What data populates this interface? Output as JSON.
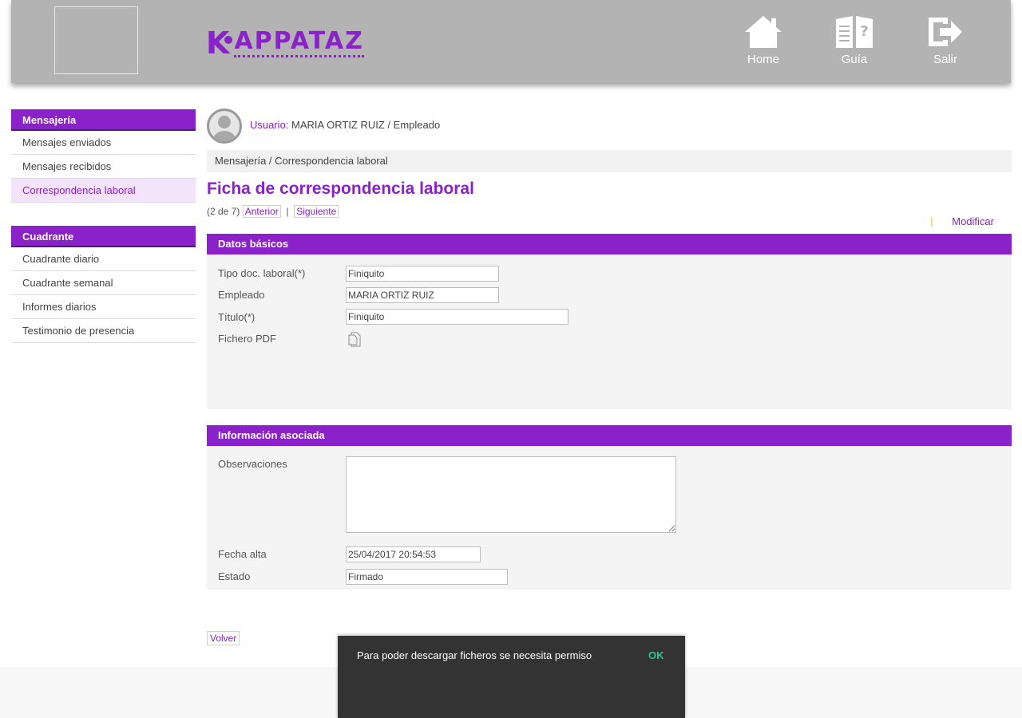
{
  "header": {
    "brand": {
      "k": "K",
      "text": "APPATAZ"
    },
    "nav": [
      {
        "label": "Home",
        "icon": "home-icon"
      },
      {
        "label": "Guía",
        "icon": "book-help-icon"
      },
      {
        "label": "Salir",
        "icon": "exit-icon"
      }
    ]
  },
  "sidebar": {
    "groups": [
      {
        "title": "Mensajería",
        "items": [
          "Mensajes enviados",
          "Mensajes recibidos",
          "Correspondencia laboral"
        ],
        "active": "Correspondencia laboral"
      },
      {
        "title": "Cuadrante",
        "items": [
          "Cuadrante diario",
          "Cuadrante semanal",
          "Informes diarios",
          "Testimonio de presencia"
        ]
      }
    ]
  },
  "user": {
    "label": "Usuario:",
    "value": "MARIA ORTIZ RUIZ / Empleado"
  },
  "breadcrumb": "Mensajería / Correspondencia laboral",
  "page_title": "Ficha de correspondencia laboral",
  "pager": {
    "position": "(2 de 7)",
    "prev": "Anterior",
    "separator": "|",
    "next": "Siguiente"
  },
  "actions": {
    "modify": "Modificar"
  },
  "sections": {
    "basic": {
      "title": "Datos básicos",
      "fields": {
        "tipo_label": "Tipo doc. laboral(*)",
        "tipo_value": "Finiquito",
        "empleado_label": "Empleado",
        "empleado_value": "MARIA ORTIZ RUIZ",
        "titulo_label": "Título(*)",
        "titulo_value": "Finiquito",
        "pdf_label": "Fichero PDF"
      }
    },
    "info": {
      "title": "Información asociada",
      "fields": {
        "obs_label": "Observaciones",
        "obs_value": "",
        "fecha_label": "Fecha alta",
        "fecha_value": "25/04/2017 20:54:53",
        "estado_label": "Estado",
        "estado_value": "Firmado"
      }
    }
  },
  "back_button": "Volver",
  "snackbar": {
    "message": "Para poder descargar ficheros se necesita permiso",
    "action": "OK"
  },
  "colors": {
    "accent": "#8a21c9",
    "header_bg": "#b3b3b3",
    "snackbar_bg": "#333333",
    "snackbar_action": "#2fc596"
  }
}
